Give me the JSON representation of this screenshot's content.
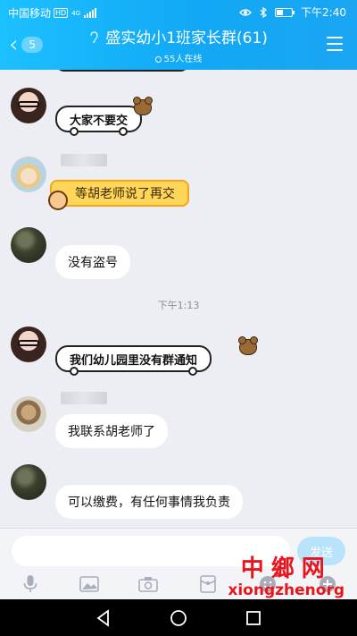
{
  "status_bar": {
    "carrier": "中国移动",
    "hd": "HD",
    "network": "4G",
    "time": "下午2:40"
  },
  "header": {
    "back_badge": "5",
    "title": "盛实幼小1班家长群(61)",
    "online": "55人在线"
  },
  "messages": [
    {
      "text": "大家不要交",
      "style": "comic"
    },
    {
      "text": "等胡老师说了再交",
      "style": "honey"
    },
    {
      "text": "没有盗号",
      "style": "plain"
    },
    {
      "time": "下午1:13"
    },
    {
      "text": "我们幼儿园里没有群通知",
      "style": "comic"
    },
    {
      "text": "我联系胡老师了",
      "style": "plain"
    },
    {
      "text": "可以缴费，有任何事情我负责",
      "style": "plain"
    }
  ],
  "input": {
    "value": "",
    "send_label": "发送"
  },
  "toolbar": [
    "microphone-icon",
    "image-icon",
    "camera-icon",
    "red-packet-icon",
    "emoji-icon",
    "plus-icon"
  ],
  "watermark": {
    "cn": "中鄉网",
    "en": "xiongzhenorg"
  },
  "colors": {
    "header": "#12a8f5",
    "send_button": "#b9e2fb",
    "chat_bg": "#eceef3",
    "watermark": "#e8161c"
  }
}
